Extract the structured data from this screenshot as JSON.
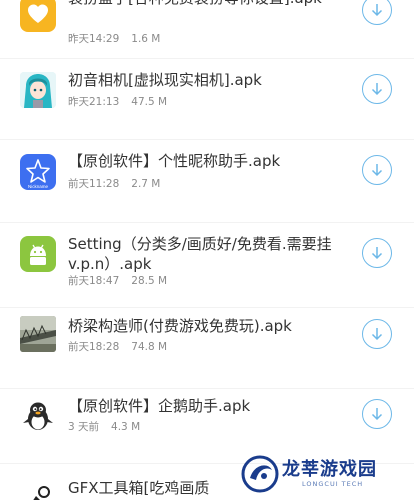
{
  "colors": {
    "download_ring": "#6db8e8",
    "title_text": "#333333",
    "meta_text": "#8a8a8a",
    "brand_blue": "#1a3c8c"
  },
  "files": [
    {
      "icon": "yellow-heart-app-icon",
      "title": "装扮盒子[各种免费装扮等你设置].apk",
      "time": "昨天14:29",
      "size": "1.6 M"
    },
    {
      "icon": "hatsune-miku-avatar-icon",
      "title": "初音相机[虚拟现实相机].apk",
      "time": "昨天21:13",
      "size": "47.5 M"
    },
    {
      "icon": "star-blue-app-icon",
      "icon_caption": "Nickname",
      "title": "【原创软件】个性昵称助手.apk",
      "time": "前天11:28",
      "size": "2.7 M"
    },
    {
      "icon": "android-robot-icon",
      "title": "Setting（分类多/画质好/免费看.需要挂v.p.n）.apk",
      "time": "前天18:47",
      "size": "28.5 M"
    },
    {
      "icon": "bridge-photo-icon",
      "title": "桥梁构造师(付费游戏免费玩).apk",
      "time": "前天18:28",
      "size": "74.8 M"
    },
    {
      "icon": "penguin-icon",
      "title": "【原创软件】企鹅助手.apk",
      "time": "3 天前",
      "size": "4.3 M"
    },
    {
      "icon": "gfx-tool-icon",
      "title": "GFX工具箱[吃鸡画质"
    }
  ],
  "watermark": {
    "name": "龙莘游戏园",
    "sub": "LONGCUI TECH"
  }
}
